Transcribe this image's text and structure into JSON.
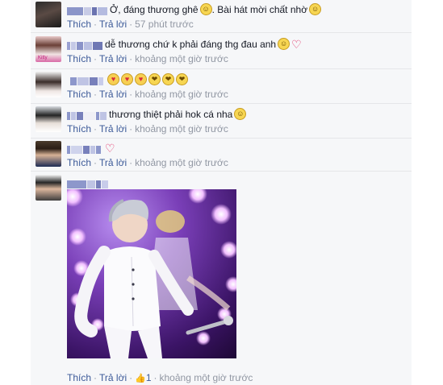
{
  "comments": [
    {
      "text": "Ở, đáng thương ghê",
      "text2": ". Bài hát mời chất nhờ",
      "like": "Thích",
      "reply": "Trả lời",
      "time": "57 phút trước"
    },
    {
      "text": "dễ thương chứ k phải đáng thg đau anh",
      "like": "Thích",
      "reply": "Trả lời",
      "time": "khoảng một giờ trước"
    },
    {
      "text": "",
      "like": "Thích",
      "reply": "Trả lời",
      "time": "khoảng một giờ trước"
    },
    {
      "text": "thương thiệt phải hok cá nha",
      "like": "Thích",
      "reply": "Trả lời",
      "time": "khoảng một giờ trước"
    },
    {
      "text": "",
      "like": "Thích",
      "reply": "Trả lời",
      "time": "khoảng một giờ trước"
    },
    {
      "text": "",
      "like": "Thích",
      "reply": "Trả lời",
      "like_count": "1",
      "time": "khoảng một giờ trước"
    }
  ],
  "colors": {
    "link": "#3b5998",
    "meta": "#9197a3",
    "background": "#f6f7f9"
  },
  "icons": [
    "smile-emoji",
    "heart-emoji",
    "love-eyes-emoji",
    "kiss-emoji",
    "thumbs-up-icon"
  ]
}
